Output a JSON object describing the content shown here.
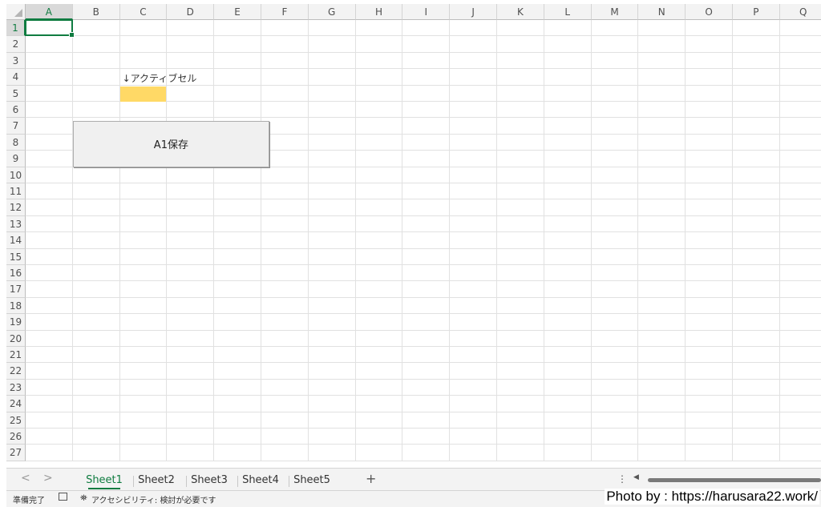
{
  "columns": [
    "A",
    "B",
    "C",
    "D",
    "E",
    "F",
    "G",
    "H",
    "I",
    "J",
    "K",
    "L",
    "M",
    "N",
    "O",
    "P",
    "Q"
  ],
  "rows": [
    "1",
    "2",
    "3",
    "4",
    "5",
    "6",
    "7",
    "8",
    "9",
    "10",
    "11",
    "12",
    "13",
    "14",
    "15",
    "16",
    "17",
    "18",
    "19",
    "20",
    "21",
    "22",
    "23",
    "24",
    "25",
    "26",
    "27"
  ],
  "active_cell": "A1",
  "highlight_cell": "C5",
  "cells": {
    "C4_text": "↓アクティブセル"
  },
  "button": {
    "label": "A1保存"
  },
  "sheet_tabs": [
    "Sheet1",
    "Sheet2",
    "Sheet3",
    "Sheet4",
    "Sheet5"
  ],
  "active_sheet": "Sheet1",
  "nav": {
    "prev": "<",
    "next": ">",
    "add": "+",
    "more": "⋮",
    "scroll_left": "◀"
  },
  "status": {
    "ready": "準備完了",
    "accessibility": "アクセシビリティ: 検討が必要です"
  },
  "watermark": "Photo by : https://harusara22.work/",
  "colors": {
    "accent": "#107c41",
    "highlight": "#ffd966"
  }
}
